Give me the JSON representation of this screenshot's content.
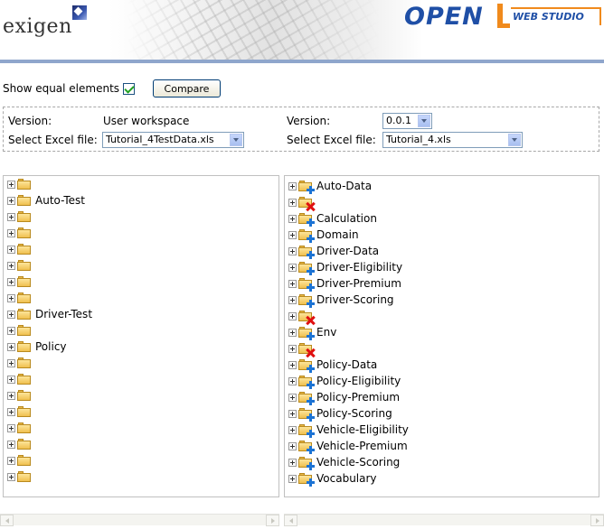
{
  "header": {
    "logo_text": "exigen",
    "product_logo": "OPEN",
    "product_subtitle": "WEB STUDIO"
  },
  "toolbar": {
    "show_equal_label": "Show equal elements",
    "show_equal_checked": true,
    "compare_label": "Compare"
  },
  "left_config": {
    "version_label": "Version:",
    "version_value": "User workspace",
    "excel_label": "Select Excel file:",
    "excel_value": "Tutorial_4TestData.xls"
  },
  "right_config": {
    "version_label": "Version:",
    "version_value": "0.0.1",
    "excel_label": "Select Excel file:",
    "excel_value": "Tutorial_4.xls"
  },
  "left_tree": [
    {
      "label": "",
      "icon": "folder-icon"
    },
    {
      "label": "Auto-Test",
      "icon": "folder-icon"
    },
    {
      "label": "",
      "icon": "folder-icon"
    },
    {
      "label": "",
      "icon": "folder-icon"
    },
    {
      "label": "",
      "icon": "folder-icon"
    },
    {
      "label": "",
      "icon": "folder-icon"
    },
    {
      "label": "",
      "icon": "folder-icon"
    },
    {
      "label": "",
      "icon": "folder-icon"
    },
    {
      "label": "Driver-Test",
      "icon": "folder-icon"
    },
    {
      "label": "",
      "icon": "folder-icon"
    },
    {
      "label": "Policy",
      "icon": "folder-icon"
    },
    {
      "label": "",
      "icon": "folder-icon"
    },
    {
      "label": "",
      "icon": "folder-icon"
    },
    {
      "label": "",
      "icon": "folder-icon"
    },
    {
      "label": "",
      "icon": "folder-icon"
    },
    {
      "label": "",
      "icon": "folder-icon"
    },
    {
      "label": "",
      "icon": "folder-icon"
    },
    {
      "label": "",
      "icon": "folder-icon"
    },
    {
      "label": "",
      "icon": "folder-icon"
    }
  ],
  "right_tree": [
    {
      "label": "Auto-Data",
      "icon": "folder-added-icon"
    },
    {
      "label": "",
      "icon": "folder-removed-icon"
    },
    {
      "label": "Calculation",
      "icon": "folder-added-icon"
    },
    {
      "label": "Domain",
      "icon": "folder-added-icon"
    },
    {
      "label": "Driver-Data",
      "icon": "folder-added-icon"
    },
    {
      "label": "Driver-Eligibility",
      "icon": "folder-added-icon"
    },
    {
      "label": "Driver-Premium",
      "icon": "folder-added-icon"
    },
    {
      "label": "Driver-Scoring",
      "icon": "folder-added-icon"
    },
    {
      "label": "",
      "icon": "folder-removed-icon"
    },
    {
      "label": "Env",
      "icon": "folder-added-icon"
    },
    {
      "label": "",
      "icon": "folder-removed-icon"
    },
    {
      "label": "Policy-Data",
      "icon": "folder-added-icon"
    },
    {
      "label": "Policy-Eligibility",
      "icon": "folder-added-icon"
    },
    {
      "label": "Policy-Premium",
      "icon": "folder-added-icon"
    },
    {
      "label": "Policy-Scoring",
      "icon": "folder-added-icon"
    },
    {
      "label": "Vehicle-Eligibility",
      "icon": "folder-added-icon"
    },
    {
      "label": "Vehicle-Premium",
      "icon": "folder-added-icon"
    },
    {
      "label": "Vehicle-Scoring",
      "icon": "folder-added-icon"
    },
    {
      "label": "Vocabulary",
      "icon": "folder-added-icon"
    }
  ],
  "colors": {
    "brand_blue": "#1f4fa6",
    "brand_orange": "#f08a1c",
    "added_badge": "#1c73d4",
    "removed_badge": "#e01010"
  }
}
